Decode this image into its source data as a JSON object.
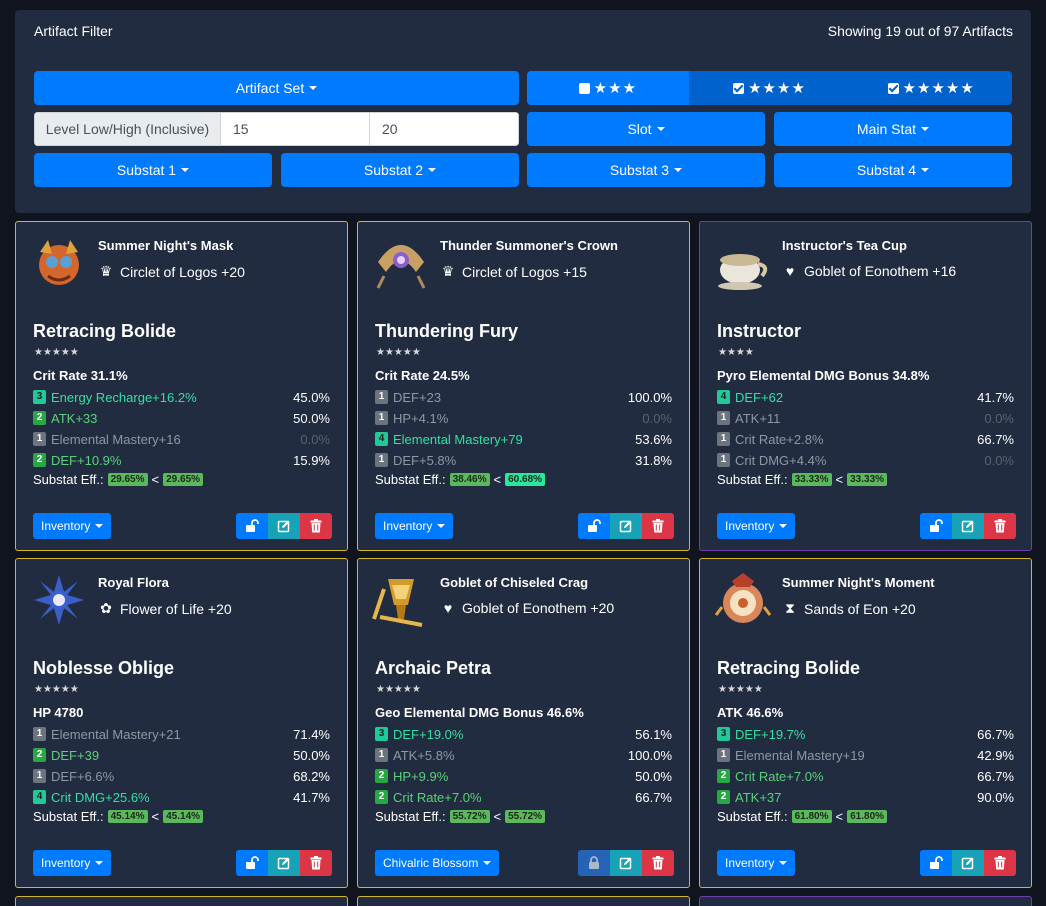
{
  "filter": {
    "title": "Artifact Filter",
    "count": "Showing 19 out of 97 Artifacts",
    "artifact_set_label": "Artifact Set",
    "rarity": [
      {
        "stars": "★★★",
        "checked": false
      },
      {
        "stars": "★★★★",
        "checked": true
      },
      {
        "stars": "★★★★★",
        "checked": true
      }
    ],
    "level_label": "Level Low/High (Inclusive)",
    "level_low": "15",
    "level_high": "20",
    "slot_label": "Slot",
    "main_stat_label": "Main Stat",
    "substat_labels": [
      "Substat 1",
      "Substat 2",
      "Substat 3",
      "Substat 4"
    ]
  },
  "cards": [
    {
      "name": "Summer Night's Mask",
      "slot_icon": "crown-icon",
      "slot": "Circlet of Logos +20",
      "set": "Retracing Bolide",
      "rarity": "★★★★★",
      "main": "Crit Rate 31.1%",
      "subs": [
        {
          "rolls": "3",
          "level": "top",
          "text": "Energy Recharge+16.2%",
          "pct": "45.0%"
        },
        {
          "rolls": "2",
          "level": "high",
          "text": "ATK+33",
          "pct": "50.0%"
        },
        {
          "rolls": "1",
          "level": "low",
          "text": "Elemental Mastery+16",
          "pct": "0.0%"
        },
        {
          "rolls": "2",
          "level": "high",
          "text": "DEF+10.9%",
          "pct": "15.9%"
        }
      ],
      "eff_label": "Substat Eff.:",
      "eff_a": "29.65%",
      "eff_b": "29.65%",
      "location": "Inventory",
      "locked": false
    },
    {
      "name": "Thunder Summoner's Crown",
      "slot_icon": "crown-icon",
      "slot": "Circlet of Logos +15",
      "set": "Thundering Fury",
      "rarity": "★★★★★",
      "main": "Crit Rate 24.5%",
      "subs": [
        {
          "rolls": "1",
          "level": "low",
          "text": "DEF+23",
          "pct": "100.0%"
        },
        {
          "rolls": "1",
          "level": "low",
          "text": "HP+4.1%",
          "pct": "0.0%"
        },
        {
          "rolls": "4",
          "level": "top",
          "text": "Elemental Mastery+79",
          "pct": "53.6%"
        },
        {
          "rolls": "1",
          "level": "low",
          "text": "DEF+5.8%",
          "pct": "31.8%"
        }
      ],
      "eff_label": "Substat Eff.:",
      "eff_a": "38.46%",
      "eff_b": "60.68%",
      "location": "Inventory",
      "locked": false
    },
    {
      "name": "Instructor's Tea Cup",
      "slot_icon": "goblet-icon",
      "slot": "Goblet of Eonothem +16",
      "set": "Instructor",
      "rarity": "★★★★",
      "main": "Pyro Elemental DMG Bonus 34.8%",
      "subs": [
        {
          "rolls": "4",
          "level": "top",
          "text": "DEF+62",
          "pct": "41.7%"
        },
        {
          "rolls": "1",
          "level": "low",
          "text": "ATK+11",
          "pct": "0.0%"
        },
        {
          "rolls": "1",
          "level": "low",
          "text": "Crit Rate+2.8%",
          "pct": "66.7%"
        },
        {
          "rolls": "1",
          "level": "low",
          "text": "Crit DMG+4.4%",
          "pct": "0.0%"
        }
      ],
      "eff_label": "Substat Eff.:",
      "eff_a": "33.33%",
      "eff_b": "33.33%",
      "location": "Inventory",
      "locked": false
    },
    {
      "name": "Royal Flora",
      "slot_icon": "flower-icon",
      "slot": "Flower of Life +20",
      "set": "Noblesse Oblige",
      "rarity": "★★★★★",
      "main": "HP 4780",
      "subs": [
        {
          "rolls": "1",
          "level": "low",
          "text": "Elemental Mastery+21",
          "pct": "71.4%"
        },
        {
          "rolls": "2",
          "level": "high",
          "text": "DEF+39",
          "pct": "50.0%"
        },
        {
          "rolls": "1",
          "level": "low",
          "text": "DEF+6.6%",
          "pct": "68.2%"
        },
        {
          "rolls": "4",
          "level": "top",
          "text": "Crit DMG+25.6%",
          "pct": "41.7%"
        }
      ],
      "eff_label": "Substat Eff.:",
      "eff_a": "45.14%",
      "eff_b": "45.14%",
      "location": "Inventory",
      "locked": false
    },
    {
      "name": "Goblet of Chiseled Crag",
      "slot_icon": "goblet-icon",
      "slot": "Goblet of Eonothem +20",
      "set": "Archaic Petra",
      "rarity": "★★★★★",
      "main": "Geo Elemental DMG Bonus 46.6%",
      "subs": [
        {
          "rolls": "3",
          "level": "top",
          "text": "DEF+19.0%",
          "pct": "56.1%"
        },
        {
          "rolls": "1",
          "level": "low",
          "text": "ATK+5.8%",
          "pct": "100.0%"
        },
        {
          "rolls": "2",
          "level": "high",
          "text": "HP+9.9%",
          "pct": "50.0%"
        },
        {
          "rolls": "2",
          "level": "high",
          "text": "Crit Rate+7.0%",
          "pct": "66.7%"
        }
      ],
      "eff_label": "Substat Eff.:",
      "eff_a": "55.72%",
      "eff_b": "55.72%",
      "location": "Chivalric Blossom",
      "locked": true
    },
    {
      "name": "Summer Night's Moment",
      "slot_icon": "hourglass-icon",
      "slot": "Sands of Eon +20",
      "set": "Retracing Bolide",
      "rarity": "★★★★★",
      "main": "ATK 46.6%",
      "subs": [
        {
          "rolls": "3",
          "level": "top",
          "text": "DEF+19.7%",
          "pct": "66.7%"
        },
        {
          "rolls": "1",
          "level": "low",
          "text": "Elemental Mastery+19",
          "pct": "42.9%"
        },
        {
          "rolls": "2",
          "level": "high",
          "text": "Crit Rate+7.0%",
          "pct": "66.7%"
        },
        {
          "rolls": "2",
          "level": "high",
          "text": "ATK+37",
          "pct": "90.0%"
        }
      ],
      "eff_label": "Substat Eff.:",
      "eff_a": "61.80%",
      "eff_b": "61.80%",
      "location": "Inventory",
      "locked": false
    }
  ]
}
